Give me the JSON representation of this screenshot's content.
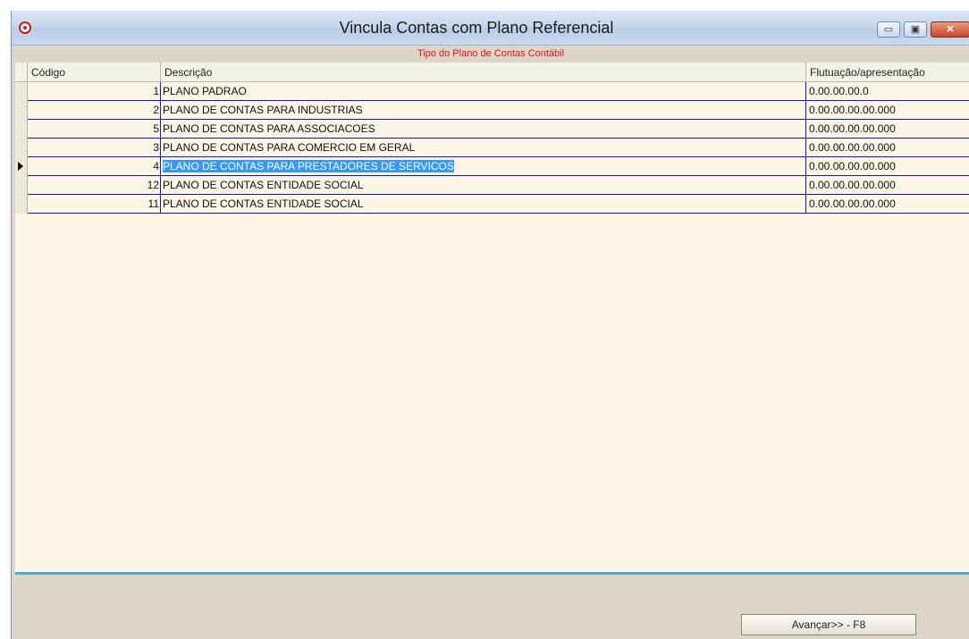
{
  "window": {
    "title": "Vincula Contas com Plano Referencial",
    "subtitle": "Tipo do Plano de Contas Contábil",
    "controls": {
      "minimize": "▭",
      "maximize": "▣",
      "close": "✕"
    }
  },
  "grid": {
    "columns": [
      "Código",
      "Descrição",
      "Flutuação/apresentação"
    ],
    "selected_row_index": 4,
    "rows": [
      {
        "codigo": "1",
        "descricao": "PLANO PADRAO",
        "flutuacao": "0.00.00.00.0"
      },
      {
        "codigo": "2",
        "descricao": "PLANO DE CONTAS PARA INDUSTRIAS",
        "flutuacao": "0.00.00.00.00.000"
      },
      {
        "codigo": "5",
        "descricao": "PLANO DE CONTAS PARA ASSOCIACOES",
        "flutuacao": "0.00.00.00.00.000"
      },
      {
        "codigo": "3",
        "descricao": "PLANO DE CONTAS PARA COMERCIO EM GERAL",
        "flutuacao": "0.00.00.00.00.000"
      },
      {
        "codigo": "4",
        "descricao": "PLANO DE CONTAS PARA PRESTADORES DE SERVICOS",
        "flutuacao": "0.00.00.00.00.000"
      },
      {
        "codigo": "12",
        "descricao": "PLANO DE CONTAS ENTIDADE SOCIAL",
        "flutuacao": "0.00.00.00.00.000"
      },
      {
        "codigo": "11",
        "descricao": "PLANO DE CONTAS ENTIDADE SOCIAL",
        "flutuacao": "0.00.00.00.00.000"
      }
    ]
  },
  "footer": {
    "next_button": "Avançar>> - F8"
  },
  "colors": {
    "subtitle": "#e0101c",
    "grid_lines": "#1414cc",
    "selection": "#3399ff",
    "divider": "#5aa8c8"
  }
}
